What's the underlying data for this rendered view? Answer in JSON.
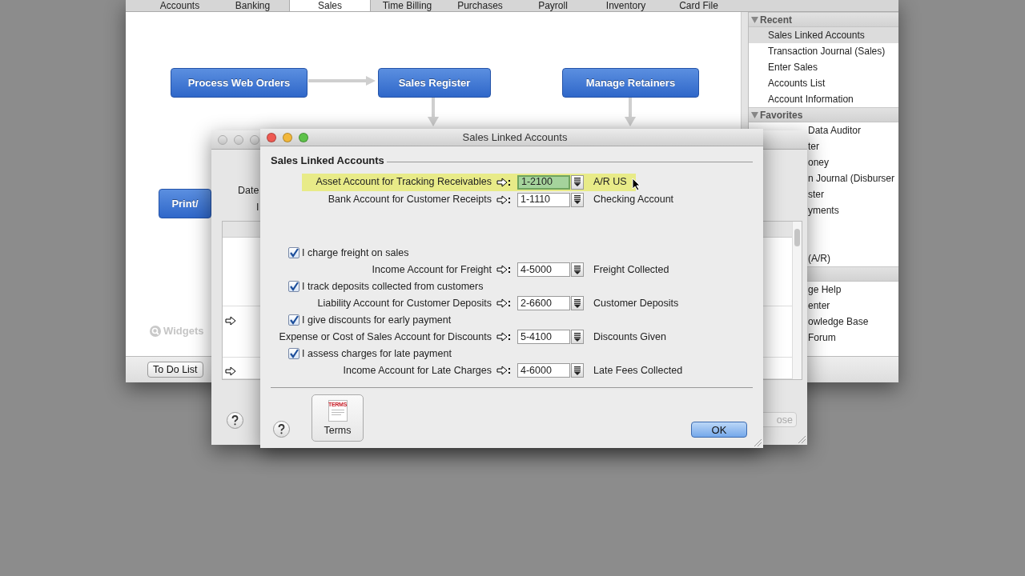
{
  "main_window": {
    "tabs": [
      {
        "label": "Accounts",
        "selected": false
      },
      {
        "label": "Banking",
        "selected": false
      },
      {
        "label": "Sales",
        "selected": true
      },
      {
        "label": "Time Billing",
        "selected": false
      },
      {
        "label": "Purchases",
        "selected": false
      },
      {
        "label": "Payroll",
        "selected": false
      },
      {
        "label": "Inventory",
        "selected": false
      },
      {
        "label": "Card File",
        "selected": false
      }
    ],
    "flow_buttons": [
      {
        "label": "Process Web Orders"
      },
      {
        "label": "Sales Register"
      },
      {
        "label": "Manage Retainers"
      },
      {
        "label": "Print/"
      }
    ],
    "widgets_label": "Widgets",
    "todo_button": "To Do List",
    "sidebar": [
      {
        "title": "Recent",
        "expanded": true,
        "items": [
          {
            "label": "Sales Linked Accounts",
            "selected": true
          },
          {
            "label": "Transaction Journal (Sales)",
            "selected": false
          },
          {
            "label": "Enter Sales",
            "selected": false
          },
          {
            "label": "Accounts List",
            "selected": false
          },
          {
            "label": "Account Information",
            "selected": false
          }
        ]
      },
      {
        "title": "Favorites",
        "expanded": true,
        "items": [
          {
            "label": "Data Auditor",
            "selected": false
          },
          {
            "label": "ter",
            "selected": false
          },
          {
            "label": "oney",
            "selected": false
          },
          {
            "label": "n Journal (Disburser",
            "selected": false
          },
          {
            "label": "ster",
            "selected": false
          },
          {
            "label": "yments",
            "selected": false
          },
          {
            "label": "(A/R)",
            "selected": false
          }
        ]
      },
      {
        "items": [
          {
            "label": "ge Help",
            "selected": false
          },
          {
            "label": "enter",
            "selected": false
          },
          {
            "label": "owledge Base",
            "selected": false
          },
          {
            "label": "Forum",
            "selected": false
          }
        ]
      }
    ]
  },
  "back_window": {
    "field_labels": [
      "Date",
      "I"
    ],
    "close_button": "ose"
  },
  "dialog": {
    "title": "Sales Linked Accounts",
    "section_title": "Sales Linked Accounts",
    "primary_rows": [
      {
        "label": "Asset Account for Tracking Receivables",
        "code": "1-2100",
        "name": "A/R US",
        "highlighted": true
      },
      {
        "label": "Bank Account for Customer Receipts",
        "code": "1-1110",
        "name": "Checking Account",
        "highlighted": false
      }
    ],
    "option_rows": [
      {
        "kind": "checkbox",
        "label": "I charge freight on sales",
        "checked": true
      },
      {
        "kind": "account",
        "label": "Income Account for Freight",
        "code": "4-5000",
        "name": "Freight Collected"
      },
      {
        "kind": "checkbox",
        "label": "I track deposits collected from customers",
        "checked": true
      },
      {
        "kind": "account",
        "label": "Liability Account for Customer Deposits",
        "code": "2-6600",
        "name": "Customer Deposits"
      },
      {
        "kind": "checkbox",
        "label": "I give discounts for early payment",
        "checked": true
      },
      {
        "kind": "account",
        "label": "Expense or Cost of Sales Account for Discounts",
        "code": "5-4100",
        "name": "Discounts Given"
      },
      {
        "kind": "checkbox",
        "label": "I assess charges for late payment",
        "checked": true
      },
      {
        "kind": "account",
        "label": "Income Account for Late Charges",
        "code": "4-6000",
        "name": "Late Fees Collected"
      }
    ],
    "terms_button": {
      "icon_text": "TERMS",
      "label": "Terms"
    },
    "ok_button": "OK"
  }
}
